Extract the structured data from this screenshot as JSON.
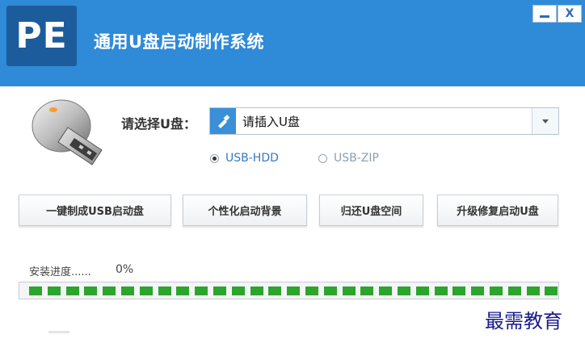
{
  "header": {
    "logo_text": "PE",
    "title": "通用U盘启动制作系统",
    "minimize_label": "—",
    "close_label": "X",
    "background": "#2f8ad8",
    "logo_background": "#1c5c9c"
  },
  "drive": {
    "label": "请选择U盘：",
    "value": "请插入U盘",
    "icon": "usb-drive-icon"
  },
  "mode": {
    "options": [
      {
        "label": "USB-HDD",
        "checked": true
      },
      {
        "label": "USB-ZIP",
        "checked": false
      }
    ]
  },
  "actions": [
    "一键制成USB启动盘",
    "个性化启动背景",
    "归还U盘空间",
    "升级修复启动U盘"
  ],
  "progress": {
    "label": "安装进度......",
    "value": "0%",
    "bar_color": "#2ca52c"
  },
  "watermark": "最需教育"
}
